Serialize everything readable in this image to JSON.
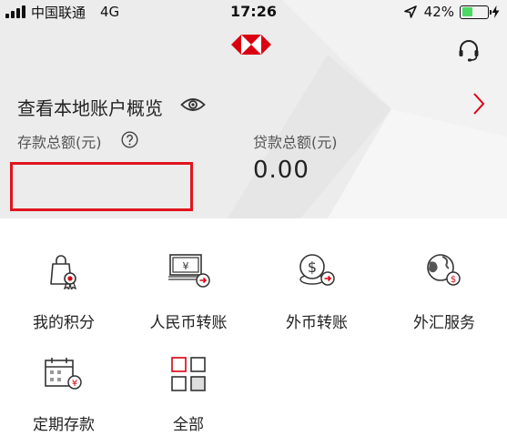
{
  "status_bar": {
    "carrier": "中国联通",
    "network": "4G",
    "time": "17:26",
    "battery_percent": "42%",
    "battery_level": 0.42
  },
  "header": {
    "logo_icon": "hsbc-hexagon-logo",
    "support_icon": "headset-icon",
    "overview_title": "查看本地账户概览",
    "deposit_label": "存款总额(元)",
    "loan_label": "贷款总额(元)",
    "loan_value": "0.00"
  },
  "grid": [
    {
      "label": "我的积分",
      "icon": "shopping-bag-badge-icon"
    },
    {
      "label": "人民币转账",
      "icon": "cny-transfer-icon"
    },
    {
      "label": "外币转账",
      "icon": "foreign-currency-transfer-icon"
    },
    {
      "label": "外汇服务",
      "icon": "fx-globe-icon"
    },
    {
      "label": "定期存款",
      "icon": "calendar-deposit-icon"
    },
    {
      "label": "全部",
      "icon": "grid-all-icon"
    }
  ],
  "colors": {
    "accent_red": "#e0141e",
    "header_bg": "#ececec",
    "battery_green": "#4cd964"
  }
}
